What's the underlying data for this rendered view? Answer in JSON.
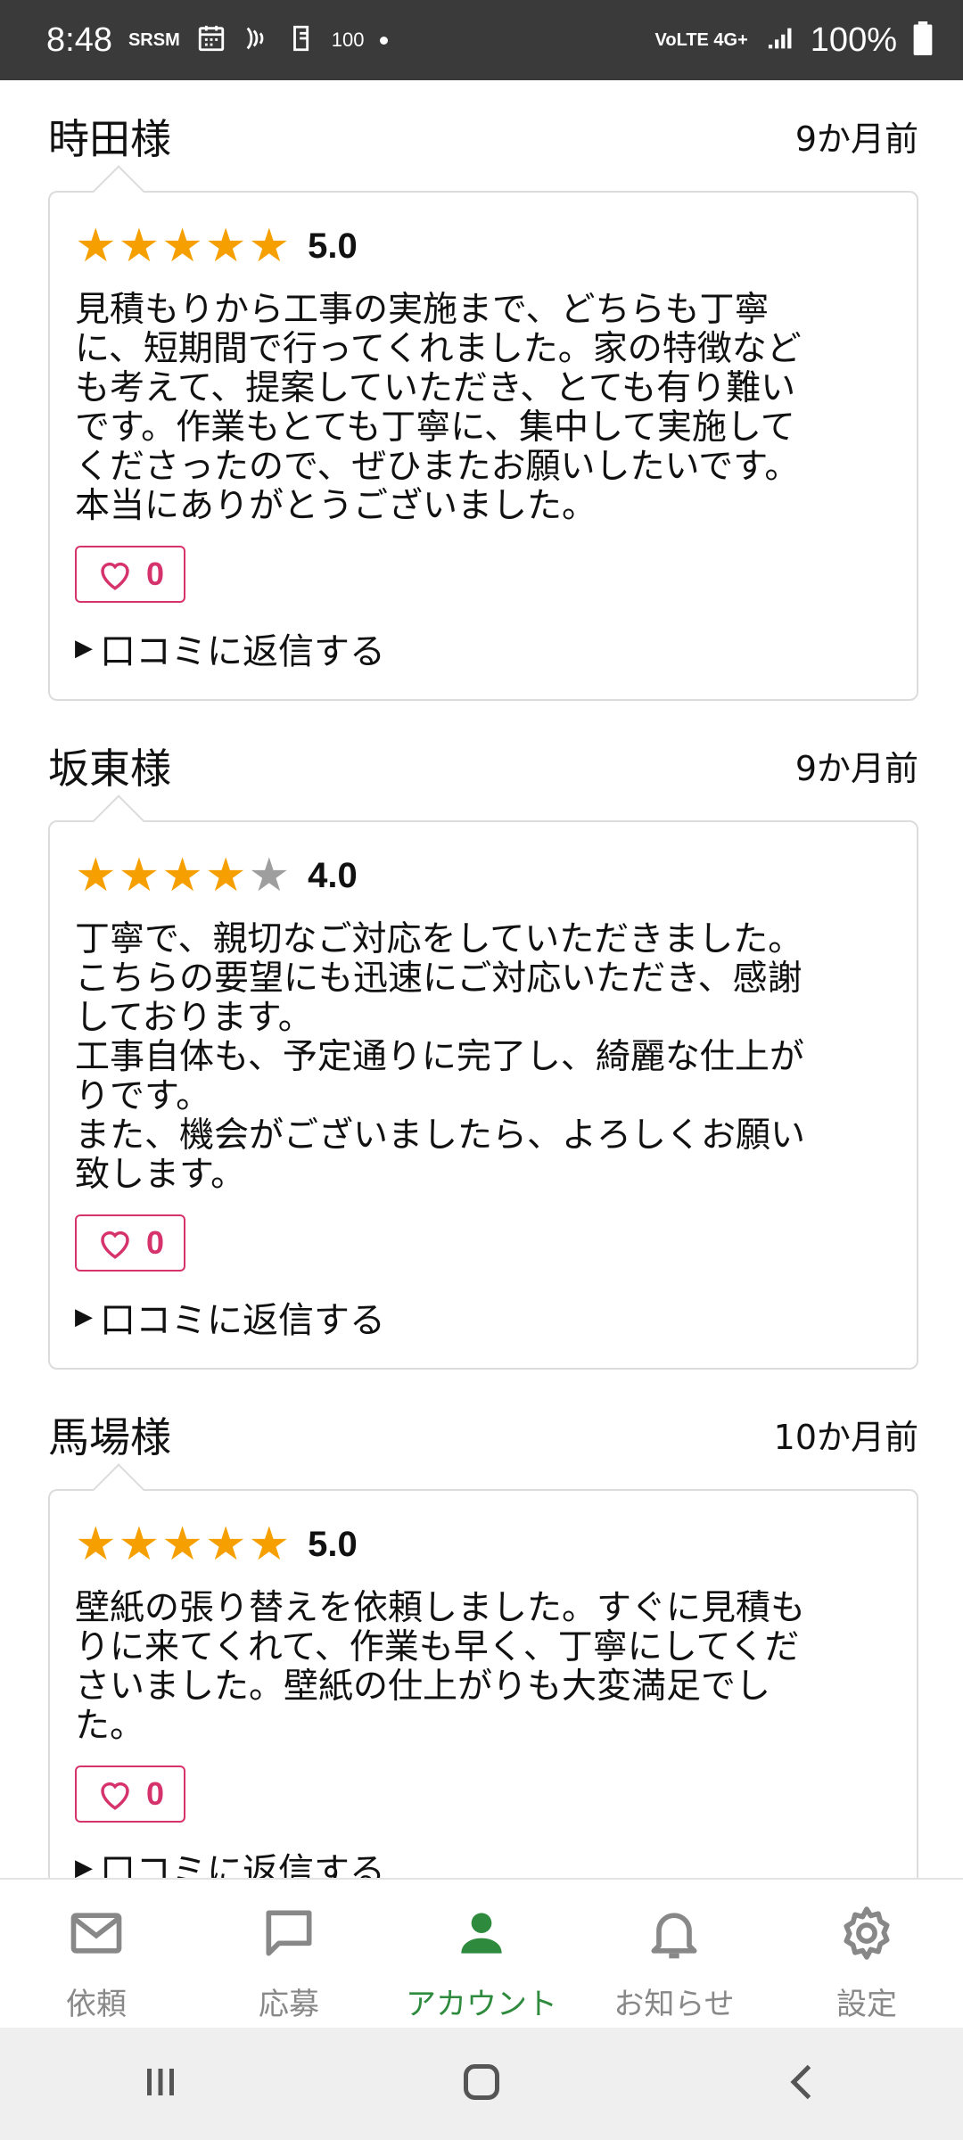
{
  "status_bar": {
    "time": "8:48",
    "left_icons": [
      "SRSM",
      "calendar-icon",
      "nfc-icon",
      "app-icon"
    ],
    "left_number": "100",
    "network": "VoLTE 4G+",
    "battery": "100%"
  },
  "reviews": [
    {
      "name": "時田様",
      "date": "9か月前",
      "stars": 5,
      "score": "5.0",
      "text": "見積もりから工事の実施まで、どちらも丁寧\nに、短期間で行ってくれました。家の特徴など\nも考えて、提案していただき、とても有り難い\nです。作業もとても丁寧に、集中して実施して\nくださったので、ぜひまたお願いしたいです。\n本当にありがとうございました。",
      "likes": "0",
      "reply_label": "口コミに返信する"
    },
    {
      "name": "坂東様",
      "date": "9か月前",
      "stars": 4,
      "score": "4.0",
      "text": "丁寧で、親切なご対応をしていただきました。\nこちらの要望にも迅速にご対応いただき、感謝\nしております。\n工事自体も、予定通りに完了し、綺麗な仕上が\nりです。\nまた、機会がございましたら、よろしくお願い\n致します。",
      "likes": "0",
      "reply_label": "口コミに返信する"
    },
    {
      "name": "馬場様",
      "date": "10か月前",
      "stars": 5,
      "score": "5.0",
      "text": "壁紙の張り替えを依頼しました。すぐに見積も\nりに来てくれて、作業も早く、丁寧にしてくだ\nさいました。壁紙の仕上がりも大変満足でし\nた。",
      "likes": "0",
      "reply_label": "口コミに返信する"
    }
  ],
  "bottom_nav": [
    {
      "label": "依頼",
      "icon": "mail-icon",
      "active": false
    },
    {
      "label": "応募",
      "icon": "chat-icon",
      "active": false
    },
    {
      "label": "アカウント",
      "icon": "person-icon",
      "active": true
    },
    {
      "label": "お知らせ",
      "icon": "bell-icon",
      "active": false
    },
    {
      "label": "設定",
      "icon": "gear-icon",
      "active": false
    }
  ],
  "colors": {
    "star_on": "#f5a000",
    "star_off": "#9e9e9e",
    "like": "#d6336c",
    "nav_active": "#2e8b3d",
    "nav_inactive": "#888888"
  }
}
